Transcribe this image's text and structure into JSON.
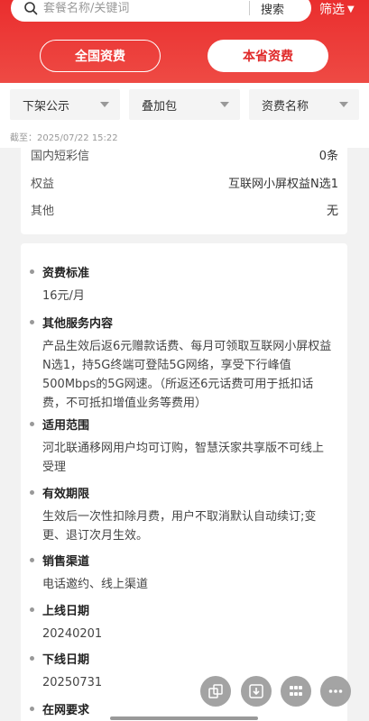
{
  "search": {
    "placeholder": "套餐名称/关键词",
    "button_label": "搜索"
  },
  "filter_link": {
    "label": "筛选"
  },
  "tabs": [
    {
      "label": "全国资费",
      "active": false
    },
    {
      "label": "本省资费",
      "active": true
    }
  ],
  "filters": [
    {
      "label": "下架公示"
    },
    {
      "label": "叠加包"
    },
    {
      "label": "资费名称"
    }
  ],
  "deadline": "截至：2025/07/22 15:22",
  "card_top": {
    "rows": [
      {
        "key": "国内短彩信",
        "value": "0条"
      },
      {
        "key": "权益",
        "value": "互联网小屏权益N选1"
      },
      {
        "key": "其他",
        "value": "无"
      }
    ]
  },
  "details": [
    {
      "title": "资费标准",
      "body": "16元/月"
    },
    {
      "title": "其他服务内容",
      "body": "产品生效后返6元赠款话费、每月可领取互联网小屏权益N选1，持5G终端可登陆5G网络，享受下行峰值500Mbps的5G网速。（所返还6元话费可用于抵扣话费，不可抵扣增值业务等费用）"
    },
    {
      "title": "适用范围",
      "body": "河北联通移网用户均可订购，智慧沃家共享版不可线上受理"
    },
    {
      "title": "有效期限",
      "body": "生效后一次性扣除月费，用户不取消默认自动续订;变更、退订次月生效。"
    },
    {
      "title": "销售渠道",
      "body": "电话邀约、线上渠道"
    },
    {
      "title": "上线日期",
      "body": "20240201"
    },
    {
      "title": "下线日期",
      "body": "20250731"
    },
    {
      "title": "在网要求",
      "body": ""
    }
  ],
  "colors": {
    "brand_red": "#e82c2c",
    "active_tab_text": "#e02a2a"
  },
  "fabs": [
    {
      "icon": "compare-icon"
    },
    {
      "icon": "download-icon"
    },
    {
      "icon": "grid-icon"
    },
    {
      "icon": "more-icon"
    }
  ]
}
